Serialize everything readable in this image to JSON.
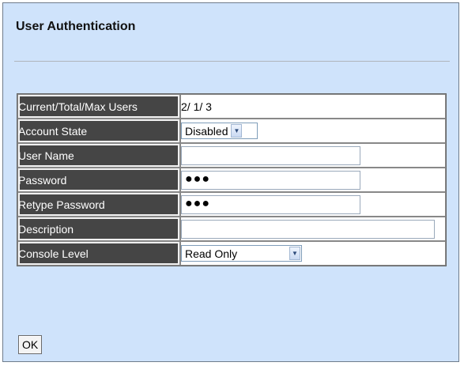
{
  "page": {
    "title": "User Authentication"
  },
  "form": {
    "users_label": "Current/Total/Max Users",
    "users_value": "2/ 1/ 3",
    "account_state_label": "Account State",
    "account_state_value": "Disabled",
    "username_label": "User Name",
    "username_value": "",
    "password_label": "Password",
    "password_value": "●●●",
    "retype_label": "Retype Password",
    "retype_value": "●●●",
    "description_label": "Description",
    "description_value": "",
    "console_level_label": "Console Level",
    "console_level_value": "Read Only"
  },
  "buttons": {
    "ok": "OK"
  },
  "icons": {
    "dropdown": "chevron-down-icon"
  }
}
